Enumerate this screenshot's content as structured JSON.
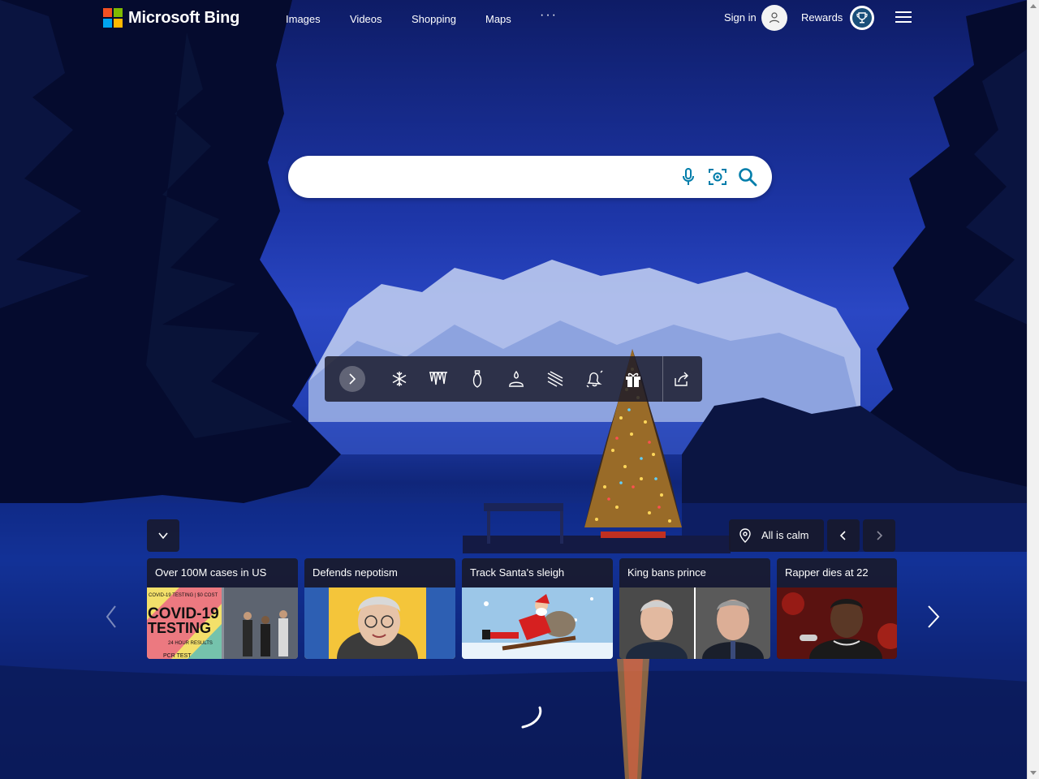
{
  "header": {
    "logo_text": "Microsoft Bing",
    "nav": [
      "Images",
      "Videos",
      "Shopping",
      "Maps"
    ],
    "more": "···",
    "signin_label": "Sign in",
    "rewards_label": "Rewards"
  },
  "search": {
    "value": "",
    "placeholder": ""
  },
  "toolbar": {
    "icons": [
      "expand-arrow-icon",
      "snowflake-icon",
      "icicles-icon",
      "ornament-icon",
      "candle-icon",
      "snowfall-icon",
      "bell-icon",
      "gift-icon",
      "share-icon"
    ]
  },
  "news": {
    "location_label": "All is calm",
    "cards": [
      {
        "title": "Over 100M cases in US"
      },
      {
        "title": "Defends nepotism"
      },
      {
        "title": "Track Santa's sleigh"
      },
      {
        "title": "King bans prince"
      },
      {
        "title": "Rapper dies at 22"
      }
    ],
    "covid_sign": {
      "line1": "COVID-19 TESTING | $0 COST",
      "line2": "COVID-19",
      "line3": "TESTING",
      "line4": "24 HOUR RESULTS",
      "line5": "PCR TEST"
    }
  },
  "colors": {
    "accent": "#007daa",
    "panel": "#19192a",
    "sky": "#1d36a8"
  }
}
